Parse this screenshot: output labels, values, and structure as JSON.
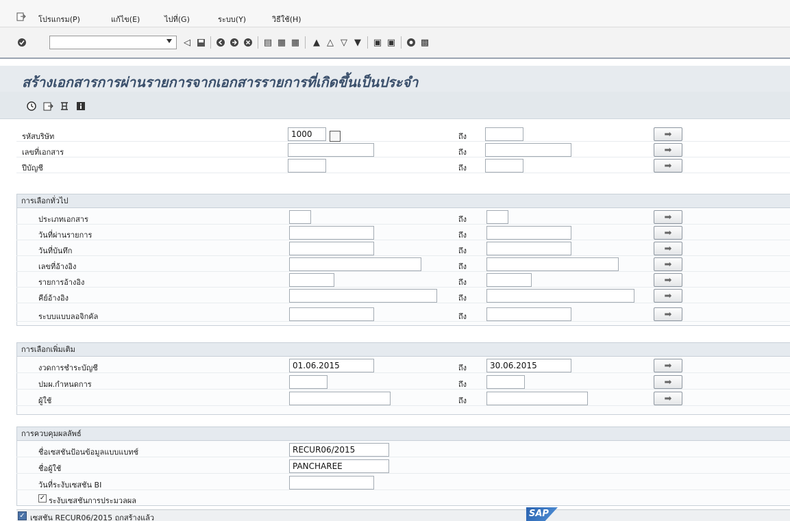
{
  "menu": {
    "items": [
      "โปรแกรม(P)",
      "แก้ไข(E)",
      "ไปที่(G)",
      "ระบบ(Y)",
      "วิธีใช้(H)"
    ]
  },
  "toolbar": {
    "command_field_value": "",
    "icons": [
      "enter-icon",
      "back-icon",
      "save-icon",
      "back-nav-icon",
      "exit-icon",
      "cancel-icon",
      "print-icon",
      "find-icon",
      "find-next-icon",
      "first-page-icon",
      "previous-page-icon",
      "next-page-icon",
      "last-page-icon",
      "new-session-icon",
      "shortcut-icon",
      "help-icon",
      "layout-icon"
    ]
  },
  "title": "สร้างเอกสารการผ่านรายการจากเอกสารรายการที่เกิดขึ้นเป็นประจำ",
  "app_toolbar_icons": [
    "execute-icon",
    "variant-icon",
    "selection-options-icon",
    "info-icon"
  ],
  "to_label": "ถึง",
  "top_fields": [
    {
      "label": "รหัสบริษัท",
      "from": "1000",
      "to": ""
    },
    {
      "label": "เลขที่เอกสาร",
      "from": "",
      "to": ""
    },
    {
      "label": "ปีบัญชี",
      "from": "",
      "to": ""
    }
  ],
  "general": {
    "title": "การเลือกทั่วไป",
    "fields": [
      {
        "label": "ประเภทเอกสาร",
        "from": "",
        "to": ""
      },
      {
        "label": "วันที่ผ่านรายการ",
        "from": "",
        "to": ""
      },
      {
        "label": "วันที่บันทึก",
        "from": "",
        "to": ""
      },
      {
        "label": "เลขที่อ้างอิง",
        "from": "",
        "to": ""
      },
      {
        "label": "รายการอ้างอิง",
        "from": "",
        "to": ""
      },
      {
        "label": "คีย์อ้างอิง",
        "from": "",
        "to": ""
      },
      {
        "label": "ระบบแบบลอจิกคัล",
        "from": "",
        "to": ""
      }
    ]
  },
  "additional": {
    "title": "การเลือกเพิ่มเติม",
    "fields": [
      {
        "label": "งวดการชำระบัญชี",
        "from": "01.06.2015",
        "to": "30.06.2015"
      },
      {
        "label": "ปมผ.กำหนดการ",
        "from": "",
        "to": ""
      },
      {
        "label": "ผู้ใช้",
        "from": "",
        "to": ""
      }
    ]
  },
  "output": {
    "title": "การควบคุมผลลัพธ์",
    "fields": [
      {
        "label": "ชื่อเซสชันป้อนข้อมูลแบบแบทช์",
        "value": "RECUR06/2015"
      },
      {
        "label": "ชื่อผู้ใช้",
        "value": "PANCHAREE"
      },
      {
        "label": "วันที่ระงับเซสชัน BI",
        "value": ""
      }
    ],
    "checkbox_label": "ระงับเซสชันการประมวลผล",
    "checkbox_checked": true
  },
  "status": {
    "message": "เซสชัน RECUR06/2015 ถูกสร้างแล้ว"
  },
  "logo": "SAP"
}
